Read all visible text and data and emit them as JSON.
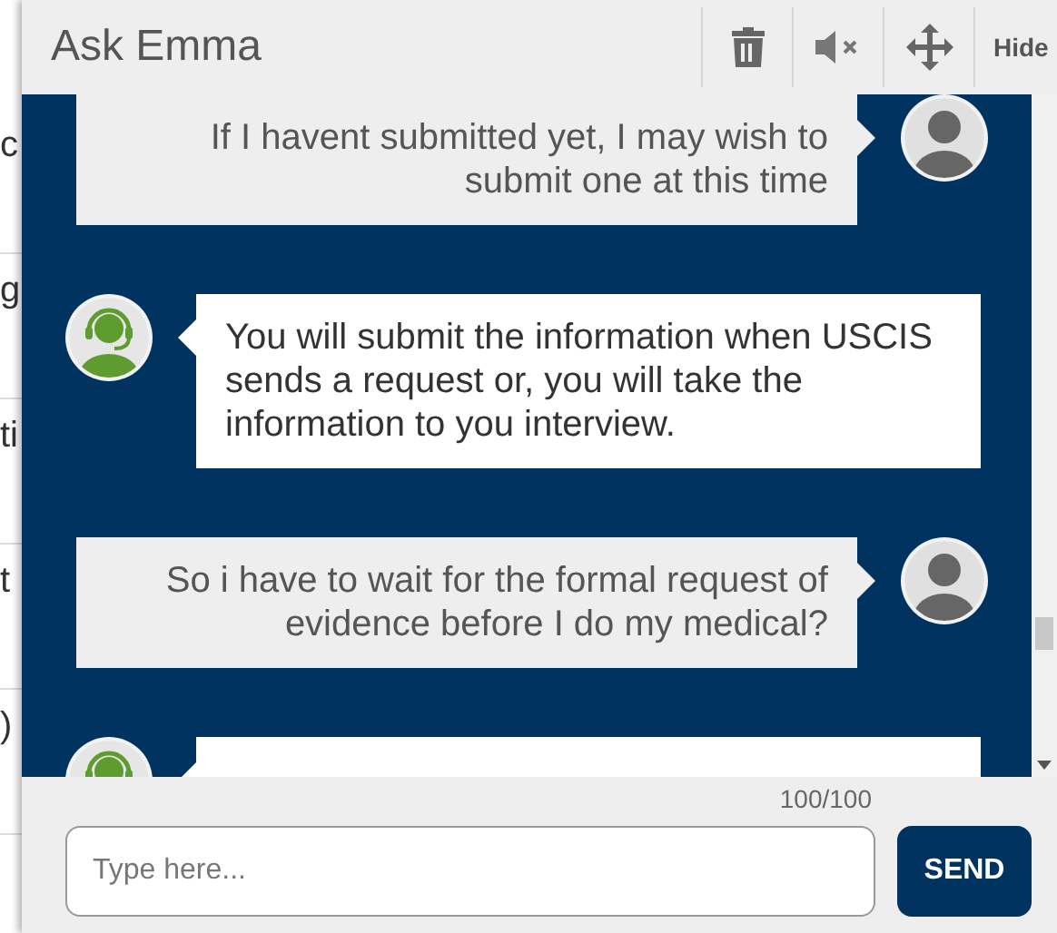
{
  "background_page": {
    "fragments": [
      "c",
      "g",
      "ti",
      "t",
      ")"
    ]
  },
  "window": {
    "title": "Ask Emma",
    "hide_label": "Hide"
  },
  "messages": [
    {
      "kind": "user",
      "text": "If I havent submitted yet, I may wish to submit one at this time"
    },
    {
      "kind": "bot",
      "text": "You will submit the information when USCIS sends a request or, you will take the information to you interview."
    },
    {
      "kind": "user",
      "text": "So i have to wait for the formal request of evidence before I do my medical?"
    },
    {
      "kind": "bot"
    }
  ],
  "composer": {
    "counter": "100/100",
    "placeholder": "Type here...",
    "send_label": "SEND"
  }
}
